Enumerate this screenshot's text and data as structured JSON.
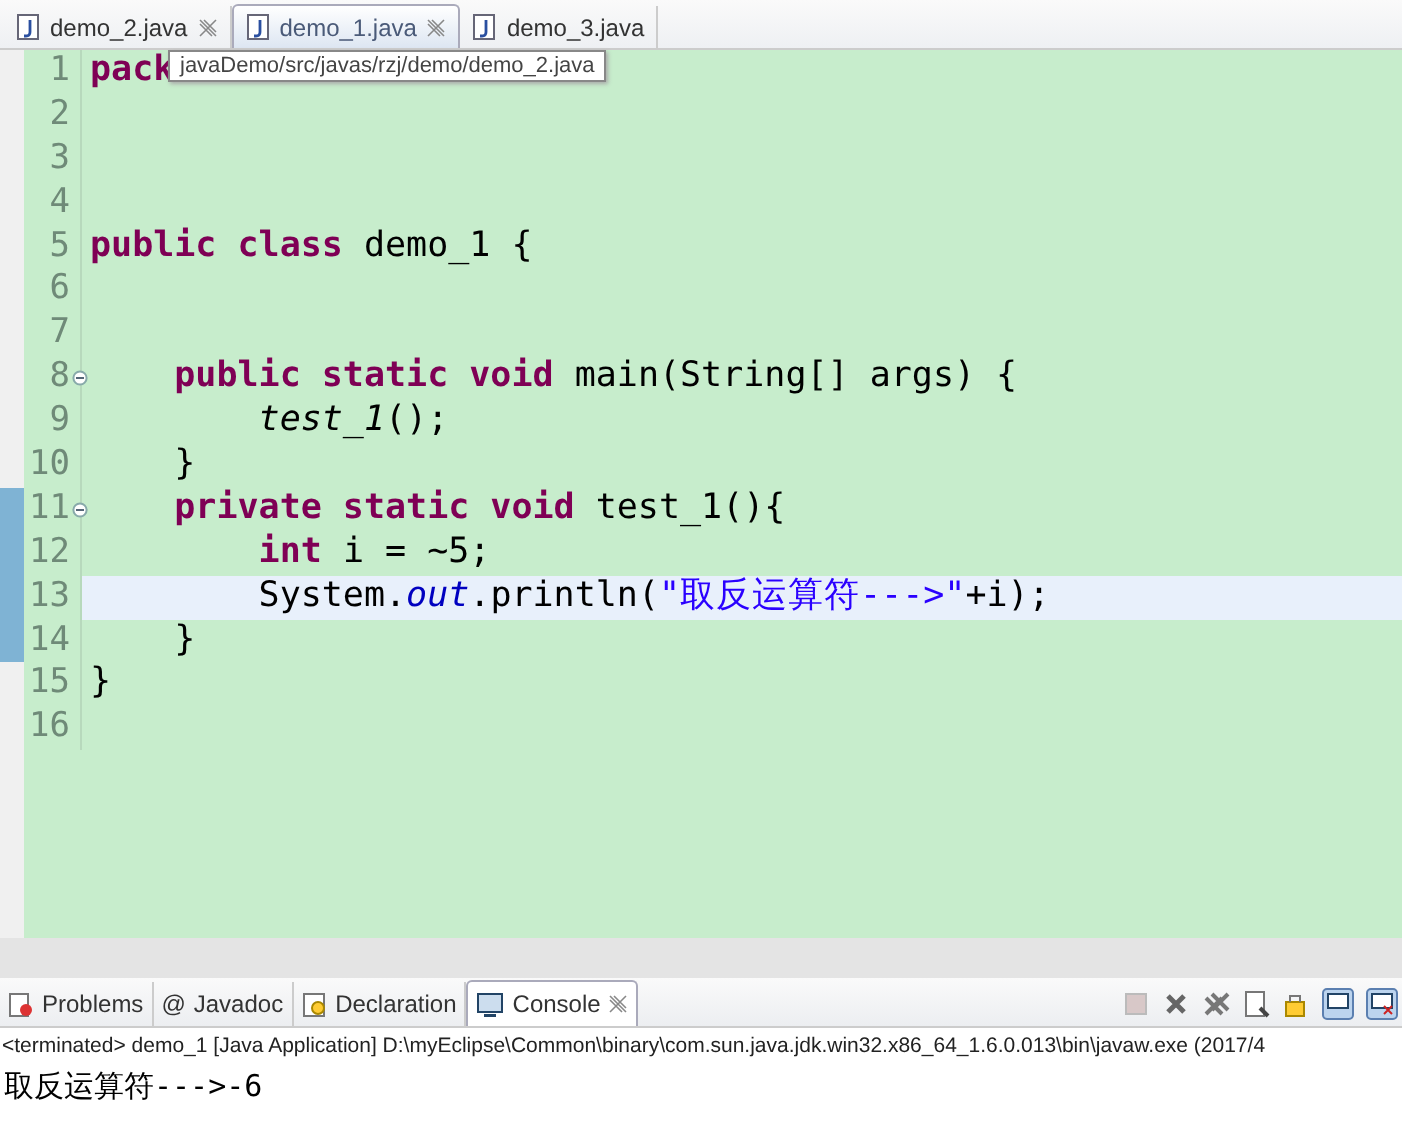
{
  "editor_tabs": [
    {
      "label": "demo_2.java",
      "selected": false,
      "closable": true
    },
    {
      "label": "demo_1.java",
      "selected": true,
      "closable": true
    },
    {
      "label": "demo_3.java",
      "selected": false,
      "closable": false
    }
  ],
  "tooltip": "javaDemo/src/javas/rzj/demo/demo_2.java",
  "lines": [
    {
      "number": "1",
      "tokens": [
        {
          "text": "pack",
          "kind": "keyword"
        }
      ],
      "fold": false,
      "in_range": false,
      "current": false
    },
    {
      "number": "2",
      "fold": false,
      "in_range": false,
      "current": false
    },
    {
      "number": "3",
      "fold": false,
      "in_range": false,
      "current": false
    },
    {
      "number": "4",
      "fold": false,
      "in_range": false,
      "current": false
    },
    {
      "number": "5",
      "tokens": [
        {
          "text": "public class",
          "kind": "keyword"
        },
        {
          "text": " demo_1 {",
          "kind": "plain"
        }
      ],
      "fold": false,
      "in_range": false,
      "current": false
    },
    {
      "number": "6",
      "fold": false,
      "in_range": false,
      "current": false
    },
    {
      "number": "7",
      "fold": false,
      "in_range": false,
      "current": false
    },
    {
      "number": "8",
      "tokens": [
        {
          "text": "    public static void",
          "kind": "keyword"
        },
        {
          "text": " main(String[] args) {",
          "kind": "plain"
        }
      ],
      "fold": true,
      "in_range": false,
      "current": false
    },
    {
      "number": "9",
      "tokens": [
        {
          "text": "        test_1",
          "kind": "method"
        },
        {
          "text": "();",
          "kind": "plain"
        }
      ],
      "fold": false,
      "in_range": false,
      "current": false
    },
    {
      "number": "10",
      "tokens": [
        {
          "text": "    }",
          "kind": "plain"
        }
      ],
      "fold": false,
      "in_range": false,
      "current": false
    },
    {
      "number": "11",
      "tokens": [
        {
          "text": "    private static void",
          "kind": "keyword"
        },
        {
          "text": " test_1(){",
          "kind": "plain"
        }
      ],
      "fold": true,
      "in_range": true,
      "current": false
    },
    {
      "number": "12",
      "tokens": [
        {
          "text": "        int",
          "kind": "keyword"
        },
        {
          "text": " i = ~5;",
          "kind": "plain"
        }
      ],
      "fold": false,
      "in_range": true,
      "current": false
    },
    {
      "number": "13",
      "tokens": [
        {
          "text": "        System.",
          "kind": "plain"
        },
        {
          "text": "out",
          "kind": "field"
        },
        {
          "text": ".println(",
          "kind": "plain"
        },
        {
          "text": "\"取反运算符--->\"",
          "kind": "string"
        },
        {
          "text": "+i);",
          "kind": "plain"
        }
      ],
      "fold": false,
      "in_range": true,
      "current": true
    },
    {
      "number": "14",
      "tokens": [
        {
          "text": "    }",
          "kind": "plain"
        }
      ],
      "fold": false,
      "in_range": true,
      "current": false
    },
    {
      "number": "15",
      "tokens": [
        {
          "text": "}",
          "kind": "plain"
        }
      ],
      "fold": false,
      "in_range": false,
      "current": false
    },
    {
      "number": "16",
      "fold": false,
      "in_range": false,
      "current": false
    }
  ],
  "view_tabs": [
    {
      "label": "Problems",
      "selected": false
    },
    {
      "label": "Javadoc",
      "glyph": "@",
      "selected": false
    },
    {
      "label": "Declaration",
      "selected": false
    },
    {
      "label": "Console",
      "selected": true
    }
  ],
  "console_info": "<terminated> demo_1 [Java Application] D:\\myEclipse\\Common\\binary\\com.sun.java.jdk.win32.x86_64_1.6.0.013\\bin\\javaw.exe (2017/4",
  "console_output": "取反运算符--->-6"
}
